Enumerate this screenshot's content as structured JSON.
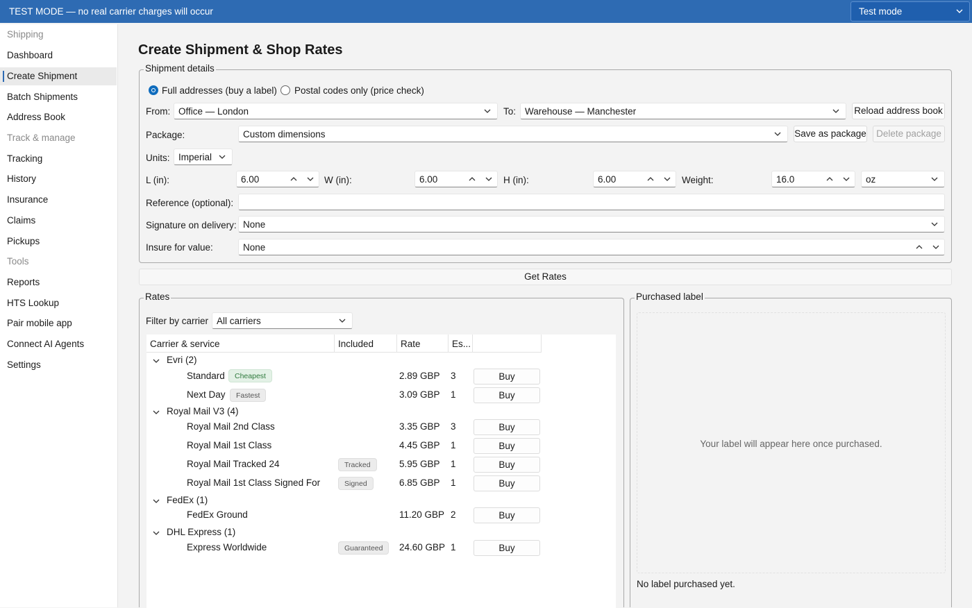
{
  "banner": {
    "text": "TEST MODE — no real carrier charges will occur",
    "mode_value": "Test mode"
  },
  "sidebar": {
    "items": [
      {
        "label": "Shipping",
        "header": true
      },
      {
        "label": "Dashboard"
      },
      {
        "label": "Create Shipment",
        "active": true
      },
      {
        "label": "Batch Shipments"
      },
      {
        "label": "Address Book"
      },
      {
        "label": "Track & manage",
        "header": true
      },
      {
        "label": "Tracking"
      },
      {
        "label": "History"
      },
      {
        "label": "Insurance"
      },
      {
        "label": "Claims"
      },
      {
        "label": "Pickups"
      },
      {
        "label": "Tools",
        "header": true
      },
      {
        "label": "Reports"
      },
      {
        "label": "HTS Lookup"
      },
      {
        "label": "Pair mobile app"
      },
      {
        "label": "Connect AI Agents"
      },
      {
        "label": "Settings"
      }
    ]
  },
  "page": {
    "title": "Create Shipment & Shop Rates"
  },
  "details": {
    "legend": "Shipment details",
    "radio_full": "Full addresses (buy a label)",
    "radio_postal": "Postal codes only (price check)",
    "from_label": "From:",
    "from_value": "Office — London",
    "to_label": "To:",
    "to_value": "Warehouse — Manchester",
    "reload_btn": "Reload address book",
    "package_label": "Package:",
    "package_value": "Custom dimensions",
    "save_pkg_btn": "Save as package",
    "delete_pkg_btn": "Delete package",
    "units_label": "Units:",
    "units_value": "Imperial",
    "l_label": "L (in):",
    "l_value": "6.00",
    "w_label": "W (in):",
    "w_value": "6.00",
    "h_label": "H (in):",
    "h_value": "6.00",
    "weight_label": "Weight:",
    "weight_value": "16.0",
    "weight_unit": "oz",
    "reference_label": "Reference (optional):",
    "reference_value": "",
    "signature_label": "Signature on delivery:",
    "signature_value": "None",
    "insure_label": "Insure for value:",
    "insure_value": "None"
  },
  "get_rates_btn": "Get Rates",
  "rates": {
    "legend": "Rates",
    "filter_label": "Filter by carrier",
    "filter_value": "All carriers",
    "columns": [
      "Carrier & service",
      "Included",
      "Rate",
      "Es..."
    ],
    "buy_label": "Buy",
    "groups": [
      {
        "name": "Evri (2)",
        "services": [
          {
            "service": "Standard",
            "badge": "Cheapest",
            "badge_style": "green",
            "included": "",
            "rate": "2.89 GBP",
            "est": "3"
          },
          {
            "service": "Next Day",
            "badge": "Fastest",
            "badge_style": "grey",
            "included": "",
            "rate": "3.09 GBP",
            "est": "1"
          }
        ]
      },
      {
        "name": "Royal Mail V3 (4)",
        "services": [
          {
            "service": "Royal Mail 2nd Class",
            "badge": "",
            "included": "",
            "rate": "3.35 GBP",
            "est": "3"
          },
          {
            "service": "Royal Mail 1st Class",
            "badge": "",
            "included": "",
            "rate": "4.45 GBP",
            "est": "1"
          },
          {
            "service": "Royal Mail Tracked 24",
            "badge": "",
            "included": "Tracked",
            "rate": "5.95 GBP",
            "est": "1"
          },
          {
            "service": "Royal Mail 1st Class Signed For",
            "badge": "",
            "included": "Signed",
            "rate": "6.85 GBP",
            "est": "1"
          }
        ]
      },
      {
        "name": "FedEx (1)",
        "services": [
          {
            "service": "FedEx Ground",
            "badge": "",
            "included": "",
            "rate": "11.20 GBP",
            "est": "2"
          }
        ]
      },
      {
        "name": "DHL Express (1)",
        "services": [
          {
            "service": "Express Worldwide",
            "badge": "",
            "included": "Guaranteed",
            "rate": "24.60 GBP",
            "est": "1"
          }
        ]
      }
    ]
  },
  "label_panel": {
    "legend": "Purchased label",
    "placeholder": "Your label will appear here once purchased.",
    "status": "No label purchased yet."
  },
  "colors": {
    "accent": "#2e6bb3",
    "radio": "#0f6cbd"
  }
}
